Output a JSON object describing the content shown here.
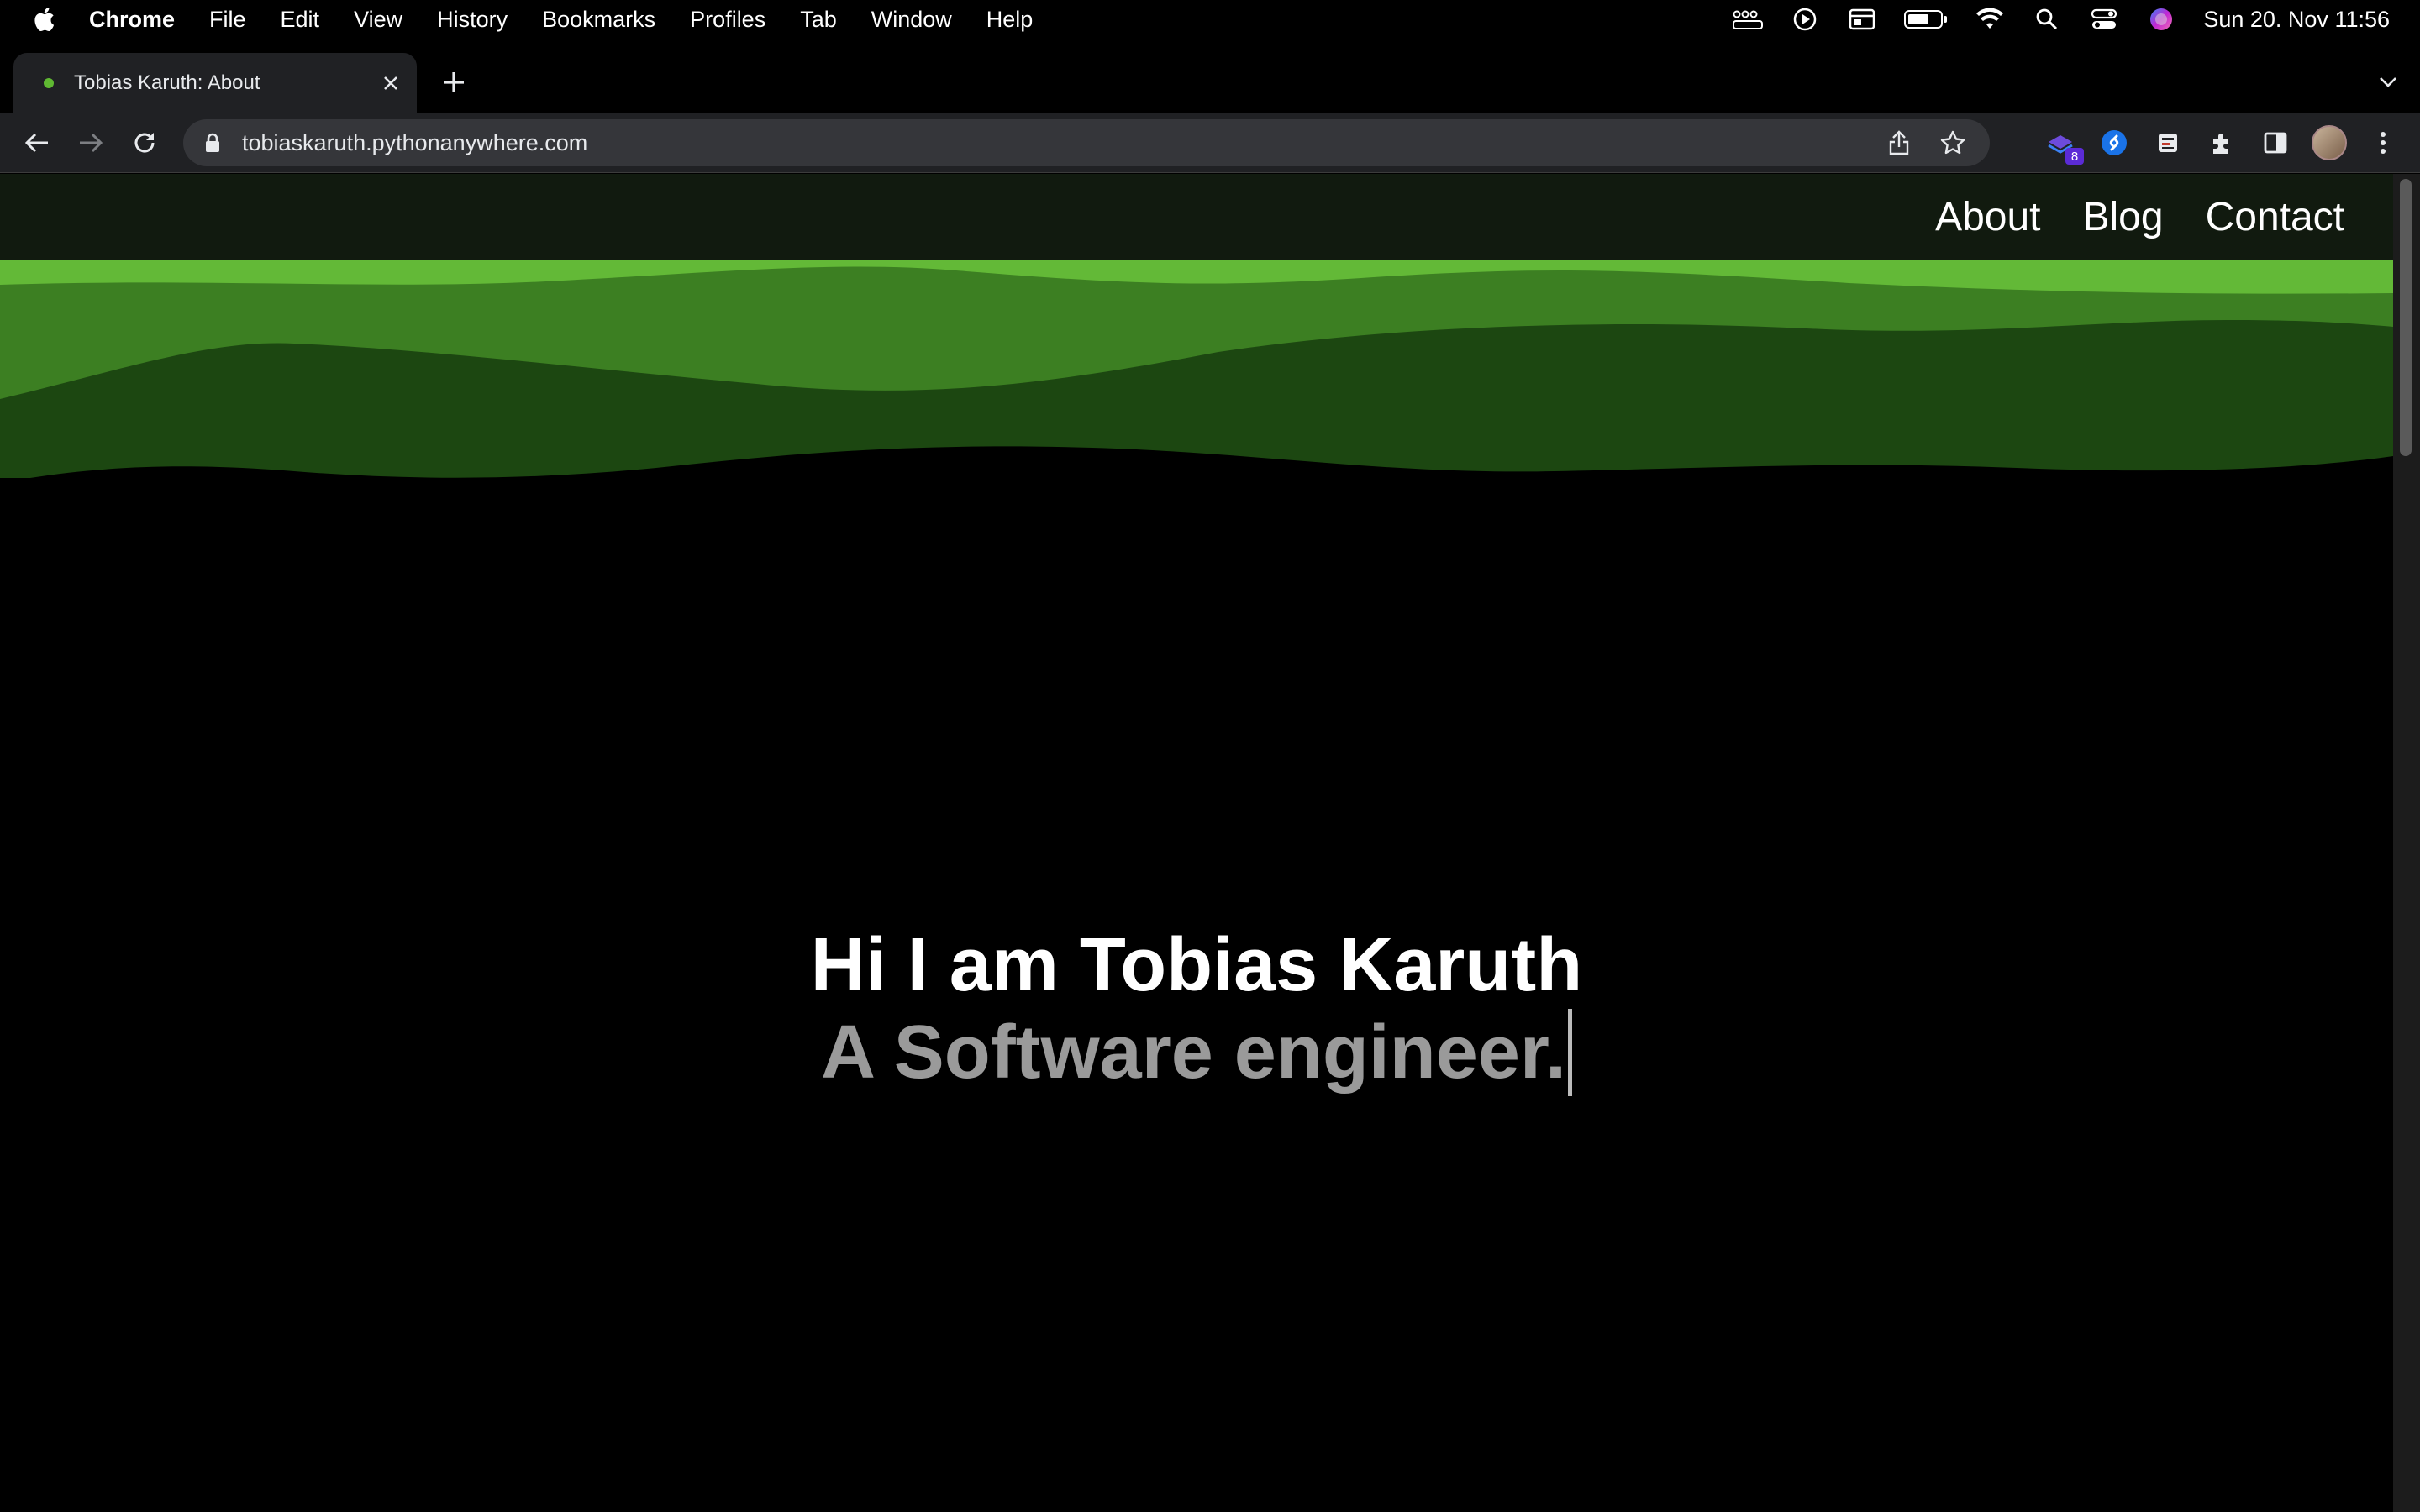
{
  "menubar": {
    "app_name": "Chrome",
    "items": [
      "File",
      "Edit",
      "View",
      "History",
      "Bookmarks",
      "Profiles",
      "Tab",
      "Window",
      "Help"
    ],
    "status_icons": [
      "dots-grid-icon",
      "play-circle-icon",
      "window-icon",
      "battery-icon",
      "wifi-icon",
      "spotlight-icon",
      "control-center-icon",
      "siri-icon"
    ],
    "clock": "Sun 20. Nov  11:56"
  },
  "browser": {
    "tab_title": "Tobias Karuth: About",
    "url": "tobiaskaruth.pythonanywhere.com",
    "extension_badge": "8"
  },
  "site": {
    "nav": {
      "about": "About",
      "blog": "Blog",
      "contact": "Contact"
    },
    "hero": {
      "headline": "Hi I am Tobias Karuth",
      "subline": "A Software engineer."
    },
    "colors": {
      "nav_bg": "#111a0f",
      "wave_light": "#63b937",
      "wave_mid": "#3c7f22",
      "wave_dark": "#1c4711",
      "page_bg": "#000000"
    }
  }
}
